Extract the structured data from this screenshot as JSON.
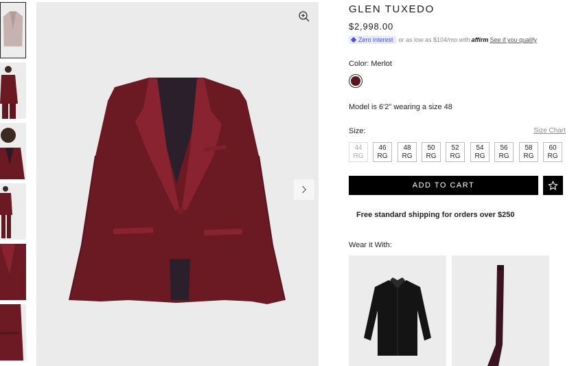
{
  "product": {
    "title": "GLEN TUXEDO",
    "price": "$2,998.00",
    "financing": {
      "badge": "Zero interest",
      "text": "or as low as $104/mo with",
      "brand": "affirm",
      "link": "See if you qualify"
    },
    "color_label": "Color: Merlot",
    "color_swatch": "#5a1520",
    "model_note": "Model is 6'2\" wearing a size 48",
    "size_label": "Size:",
    "size_chart_link": "Size Chart",
    "sizes": [
      {
        "num": "44",
        "fit": "RG",
        "available": false
      },
      {
        "num": "46",
        "fit": "RG",
        "available": true
      },
      {
        "num": "48",
        "fit": "RG",
        "available": true
      },
      {
        "num": "50",
        "fit": "RG",
        "available": true
      },
      {
        "num": "52",
        "fit": "RG",
        "available": true
      },
      {
        "num": "54",
        "fit": "RG",
        "available": true
      },
      {
        "num": "56",
        "fit": "RG",
        "available": true
      },
      {
        "num": "58",
        "fit": "RG",
        "available": true
      },
      {
        "num": "60",
        "fit": "RG",
        "available": true
      }
    ],
    "add_to_cart": "ADD TO CART",
    "shipping": "Free standard shipping for orders over $250",
    "wear_with_label": "Wear it With:"
  },
  "icons": {
    "zoom": "zoom-in-icon",
    "next": "chevron-right-icon",
    "wishlist": "star-icon"
  }
}
